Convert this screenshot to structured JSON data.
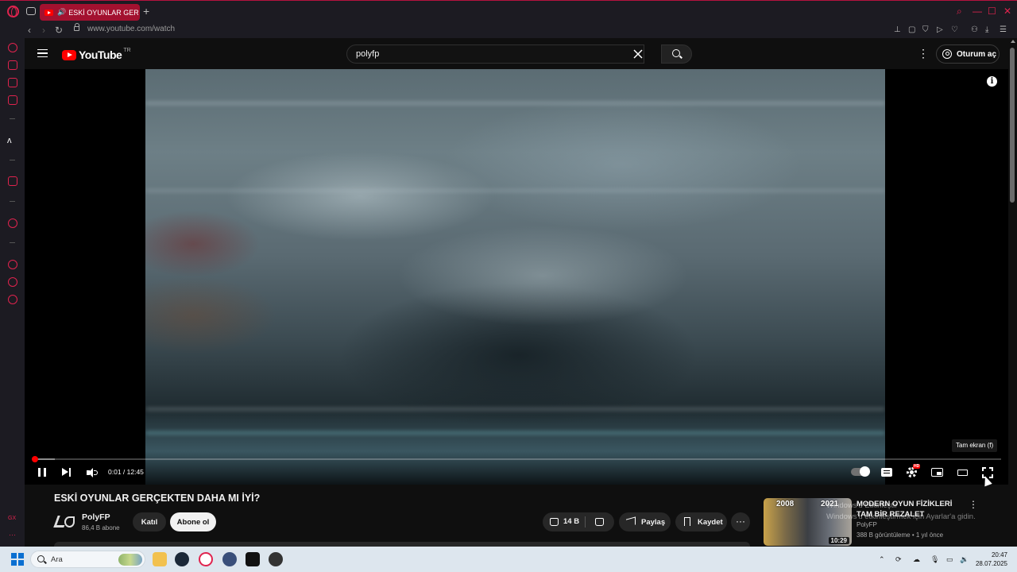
{
  "browser": {
    "tab": {
      "title": "ESKİ OYUNLAR GERÇEKTEN DAHA MI İYİ?"
    },
    "url": "www.youtube.com/watch",
    "sidebar_label": "GX"
  },
  "youtube": {
    "logo_text": "YouTube",
    "region": "TR",
    "search": {
      "value": "polyfp"
    },
    "signin_label": "Oturum aç"
  },
  "player": {
    "time_display": "0:01 / 12:45",
    "current_time": "0:01",
    "duration": "12:45",
    "progress_fraction": 0.0013,
    "buffered_fraction": 0.024,
    "tooltip": "Tam ekran (f)",
    "info_label": "i",
    "hd_badge": "HD"
  },
  "video": {
    "title": "ESKİ OYUNLAR GERÇEKTEN DAHA MI İYİ?",
    "channel": {
      "name": "PolyFP",
      "subscribers": "86,4 B abone"
    },
    "join_label": "Katıl",
    "subscribe_label": "Abone ol",
    "likes": "14 B",
    "share_label": "Paylaş",
    "save_label": "Kaydet"
  },
  "recommended": [
    {
      "title": "MODERN OYUN FİZİKLERİ TAM BİR REZALET",
      "channel": "PolyFP",
      "meta": "388 B görüntüleme • 1 yıl önce",
      "duration": "10:29",
      "years": [
        "2008",
        "2021"
      ]
    }
  ],
  "windows_watermark": {
    "line1": "Windows'u Etkinleştir",
    "line2": "Windows'u etkinleştirmek için Ayarlar'a gidin."
  },
  "taskbar": {
    "search_placeholder": "Ara",
    "time": "20:47",
    "date": "28.07.2025"
  },
  "colors": {
    "accent_red": "#ff0000",
    "opera_accent": "#e0234e",
    "background": "#0f0f0f"
  }
}
